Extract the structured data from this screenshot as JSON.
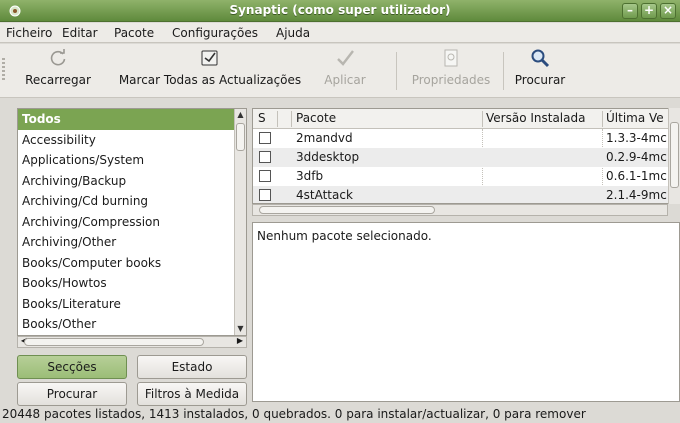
{
  "window": {
    "title": "Synaptic (como super utilizador)"
  },
  "menu": [
    "Ficheiro",
    "Editar",
    "Pacote",
    "Configurações",
    "Ajuda"
  ],
  "toolbar": {
    "reload": "Recarregar",
    "mark_all": "Marcar Todas as Actualizações",
    "apply": "Aplicar",
    "properties": "Propriedades",
    "search": "Procurar"
  },
  "sections": {
    "items": [
      "Todos",
      "Accessibility",
      "Applications/System",
      "Archiving/Backup",
      "Archiving/Cd burning",
      "Archiving/Compression",
      "Archiving/Other",
      "Books/Computer books",
      "Books/Howtos",
      "Books/Literature",
      "Books/Other"
    ],
    "selected": "Todos"
  },
  "filter_buttons": {
    "sections": "Secções",
    "status": "Estado",
    "search": "Procurar",
    "custom_filters": "Filtros à Medida"
  },
  "packages": {
    "columns": [
      "S",
      "Pacote",
      "Versão Instalada",
      "Última Ve"
    ],
    "rows": [
      {
        "name": "2mandvd",
        "installed": "",
        "latest": "1.3.3-4mc"
      },
      {
        "name": "3ddesktop",
        "installed": "",
        "latest": "0.2.9-4mc"
      },
      {
        "name": "3dfb",
        "installed": "",
        "latest": "0.6.1-1mc"
      },
      {
        "name": "4stAttack",
        "installed": "",
        "latest": "2.1.4-9mc"
      }
    ]
  },
  "details": {
    "text": "Nenhum pacote selecionado."
  },
  "status": {
    "text": "20448 pacotes listados, 1413 instalados, 0 quebrados. 0 para instalar/actualizar, 0 para remover"
  },
  "colors": {
    "selection": "#7ba452",
    "titlebar": "#6f9a4d"
  }
}
